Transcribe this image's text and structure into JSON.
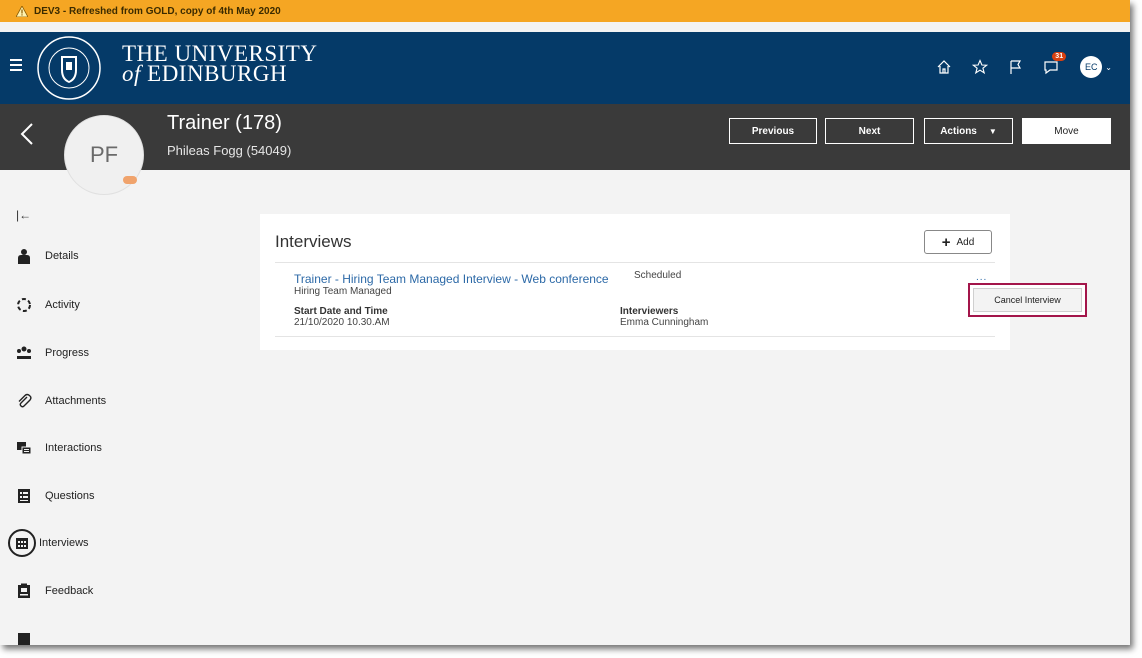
{
  "env_banner": {
    "text": "DEV3 - Refreshed from GOLD, copy of 4th May 2020"
  },
  "brand": {
    "line1": "THE UNIVERSITY",
    "line2_prefix": "of",
    "line2_rest": " EDINBURGH"
  },
  "topnav": {
    "icons": [
      "home-icon",
      "star-icon",
      "flag-icon",
      "notifications-icon"
    ],
    "notification_count": "31",
    "user_initials": "EC"
  },
  "header": {
    "job_title": "Trainer (178)",
    "candidate_name": "Phileas Fogg (54049)",
    "avatar_initials": "PF",
    "buttons": {
      "previous": "Previous",
      "next": "Next",
      "actions": "Actions",
      "move": "Move"
    }
  },
  "sidebar": {
    "items": [
      {
        "label": "Details",
        "icon": "person-icon"
      },
      {
        "label": "Activity",
        "icon": "activity-icon"
      },
      {
        "label": "Progress",
        "icon": "progress-icon"
      },
      {
        "label": "Attachments",
        "icon": "paperclip-icon"
      },
      {
        "label": "Interactions",
        "icon": "interactions-icon"
      },
      {
        "label": "Questions",
        "icon": "questions-icon"
      },
      {
        "label": "Interviews",
        "icon": "calendar-icon",
        "active": true
      },
      {
        "label": "Feedback",
        "icon": "feedback-icon"
      }
    ]
  },
  "interviews": {
    "title": "Interviews",
    "add_label": "Add",
    "item": {
      "name": "Trainer - Hiring Team Managed Interview - Web conference",
      "type": "Hiring Team Managed",
      "status": "Scheduled",
      "start_label": "Start Date and Time",
      "start_value": "21/10/2020 10.30.AM",
      "interviewers_label": "Interviewers",
      "interviewers_value": "Emma Cunningham",
      "more_label": "..."
    },
    "menu": {
      "cancel_label": "Cancel Interview"
    }
  },
  "colors": {
    "env_banner": "#f5a623",
    "topnav": "#053a68",
    "header": "#3a3a3a",
    "link": "#2c69a7",
    "highlight": "#a3154a"
  }
}
